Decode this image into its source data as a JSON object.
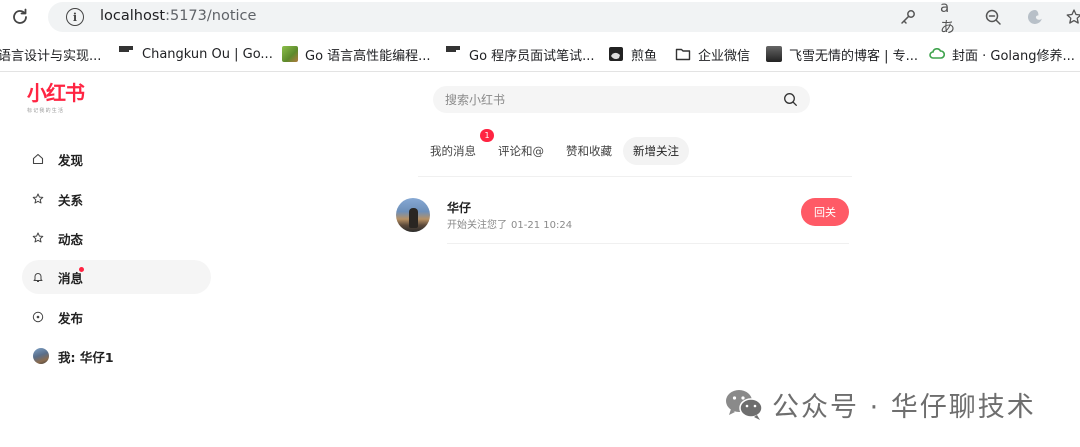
{
  "browser": {
    "url_host": "localhost",
    "url_path": ":5173/notice",
    "bookmarks": [
      {
        "label": "语言设计与实现...",
        "icon": "none"
      },
      {
        "label": "Changkun Ou | Go...",
        "icon": "lines-icon"
      },
      {
        "label": "Go 语言高性能编程...",
        "icon": "gopher-icon"
      },
      {
        "label": "Go 程序员面试笔试...",
        "icon": "lines-icon"
      },
      {
        "label": "煎鱼",
        "icon": "fish-site-icon"
      },
      {
        "label": "企业微信",
        "icon": "folder-icon"
      },
      {
        "label": "飞雪无情的博客 | 专...",
        "icon": "blog-avatar-icon"
      },
      {
        "label": "封面 · Golang修养...",
        "icon": "cloud-icon"
      }
    ]
  },
  "app": {
    "logo_text": "小红书",
    "logo_sub": "标记我的生活",
    "search_placeholder": "搜索小红书",
    "nav": [
      {
        "label": "发现",
        "icon": "home-icon",
        "active": false
      },
      {
        "label": "关系",
        "icon": "star-icon",
        "active": false
      },
      {
        "label": "动态",
        "icon": "star-icon",
        "active": false
      },
      {
        "label": "消息",
        "icon": "bell-icon",
        "active": true
      },
      {
        "label": "发布",
        "icon": "plus-circle-icon",
        "active": false
      },
      {
        "label": "我: 华仔1",
        "icon": "avatar",
        "active": false
      }
    ],
    "tabs": [
      {
        "label": "我的消息",
        "active": false
      },
      {
        "label": "评论和@",
        "active": false
      },
      {
        "label": "赞和收藏",
        "active": false
      },
      {
        "label": "新增关注",
        "active": true
      }
    ],
    "unread_badge": "1",
    "notices": [
      {
        "name": "华仔",
        "action": "开始关注您了",
        "time": "01-21 10:24",
        "button_label": "回关"
      }
    ]
  },
  "watermark": {
    "text": "公众号 · 华仔聊技术"
  },
  "colors": {
    "brand": "#ff2442",
    "follow_button": "#ff5a66"
  }
}
